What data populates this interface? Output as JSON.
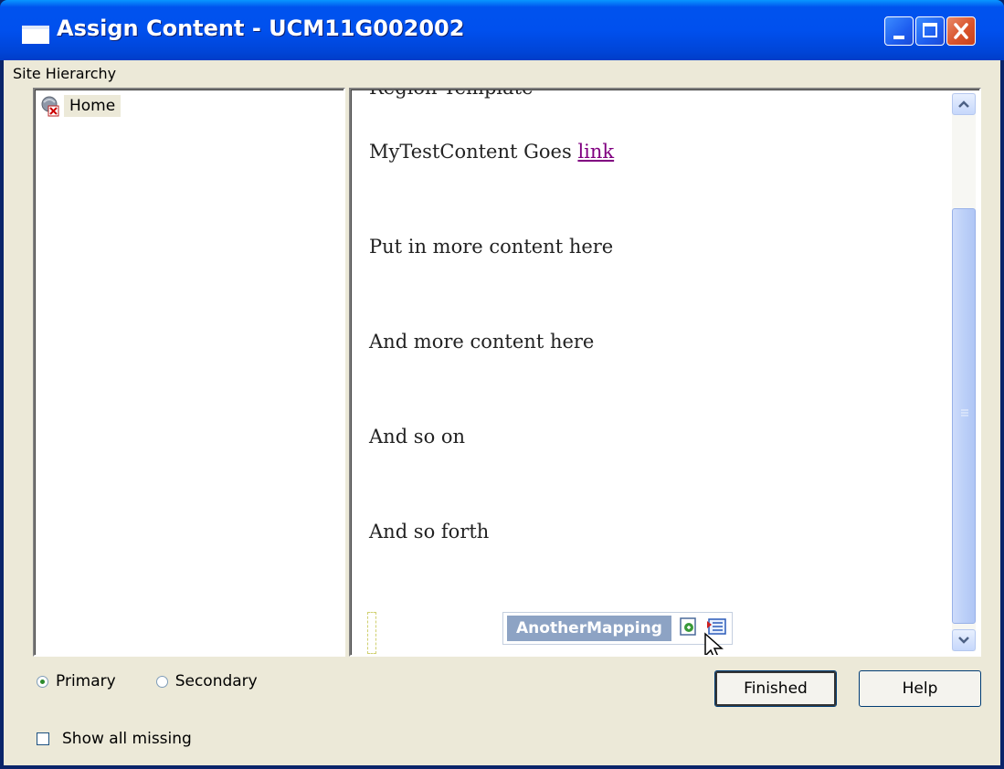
{
  "window": {
    "title": "Assign Content - UCM11G002002",
    "controls": {
      "minimize": "minimize",
      "maximize": "maximize",
      "close": "close"
    }
  },
  "site_hierarchy": {
    "label": "Site Hierarchy",
    "items": [
      {
        "label": "Home",
        "icon": "site-home-icon"
      }
    ]
  },
  "preview": {
    "cut_heading": "Region Template",
    "line1_text": "MyTestContent Goes ",
    "line1_link": "link",
    "line2": "Put in more content here",
    "line3": "And more content here",
    "line4": "And so on",
    "line5": "And so forth",
    "mapping_label": "AnotherMapping"
  },
  "options": {
    "primary": "Primary",
    "secondary": "Secondary",
    "selected": "Primary",
    "show_missing": "Show all missing",
    "show_missing_checked": false
  },
  "buttons": {
    "finished": "Finished",
    "help": "Help"
  },
  "colors": {
    "title_bar": "#0050ee",
    "client_bg": "#ece9d8",
    "link": "#800080",
    "mapping_bg": "#8da3c4"
  }
}
